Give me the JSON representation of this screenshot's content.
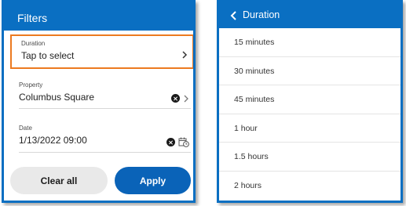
{
  "filters": {
    "title": "Filters",
    "duration": {
      "label": "Duration",
      "value": "Tap to select"
    },
    "property": {
      "label": "Property",
      "value": "Columbus Square"
    },
    "date": {
      "label": "Date",
      "value": "1/13/2022 09:00"
    },
    "clear_label": "Clear all",
    "apply_label": "Apply"
  },
  "duration_picker": {
    "title": "Duration",
    "options": [
      "15 minutes",
      "30 minutes",
      "45 minutes",
      "1 hour",
      "1.5 hours",
      "2 hours"
    ]
  },
  "colors": {
    "brand": "#0a6fc2",
    "highlight": "#ec7a20",
    "apply": "#0a63b8",
    "clear": "#e9e9e9"
  }
}
